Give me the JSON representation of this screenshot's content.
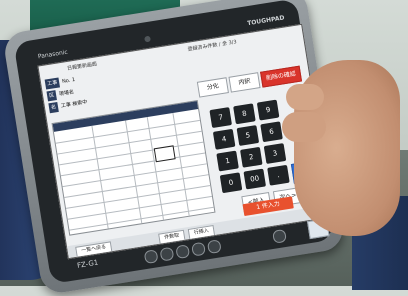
{
  "tablet": {
    "brand": "Panasonic",
    "model": "TOUGHPAD",
    "sticker": "FZ-G1"
  },
  "screen": {
    "header_left": "日報更新画面",
    "header_right": "登録済み件数 / 全 3/3",
    "info_lines": [
      {
        "tag": "工事",
        "value": "No. 1"
      },
      {
        "tag": "区",
        "value": "現場名"
      },
      {
        "tag": "名",
        "value": "工事 検索中"
      }
    ],
    "keypad_top": [
      "分化",
      "内訳",
      "削除の確認"
    ],
    "numpad": [
      "7",
      "8",
      "9",
      "4",
      "5",
      "6",
      "1",
      "2",
      "3",
      "0",
      "00",
      "."
    ],
    "nav_keys": [
      "<前入",
      "次へ>"
    ],
    "confirm": "1 件入力",
    "mode_key": "123",
    "bottom_buttons": [
      "一覧へ戻る",
      "件数取",
      "行挿入"
    ]
  }
}
